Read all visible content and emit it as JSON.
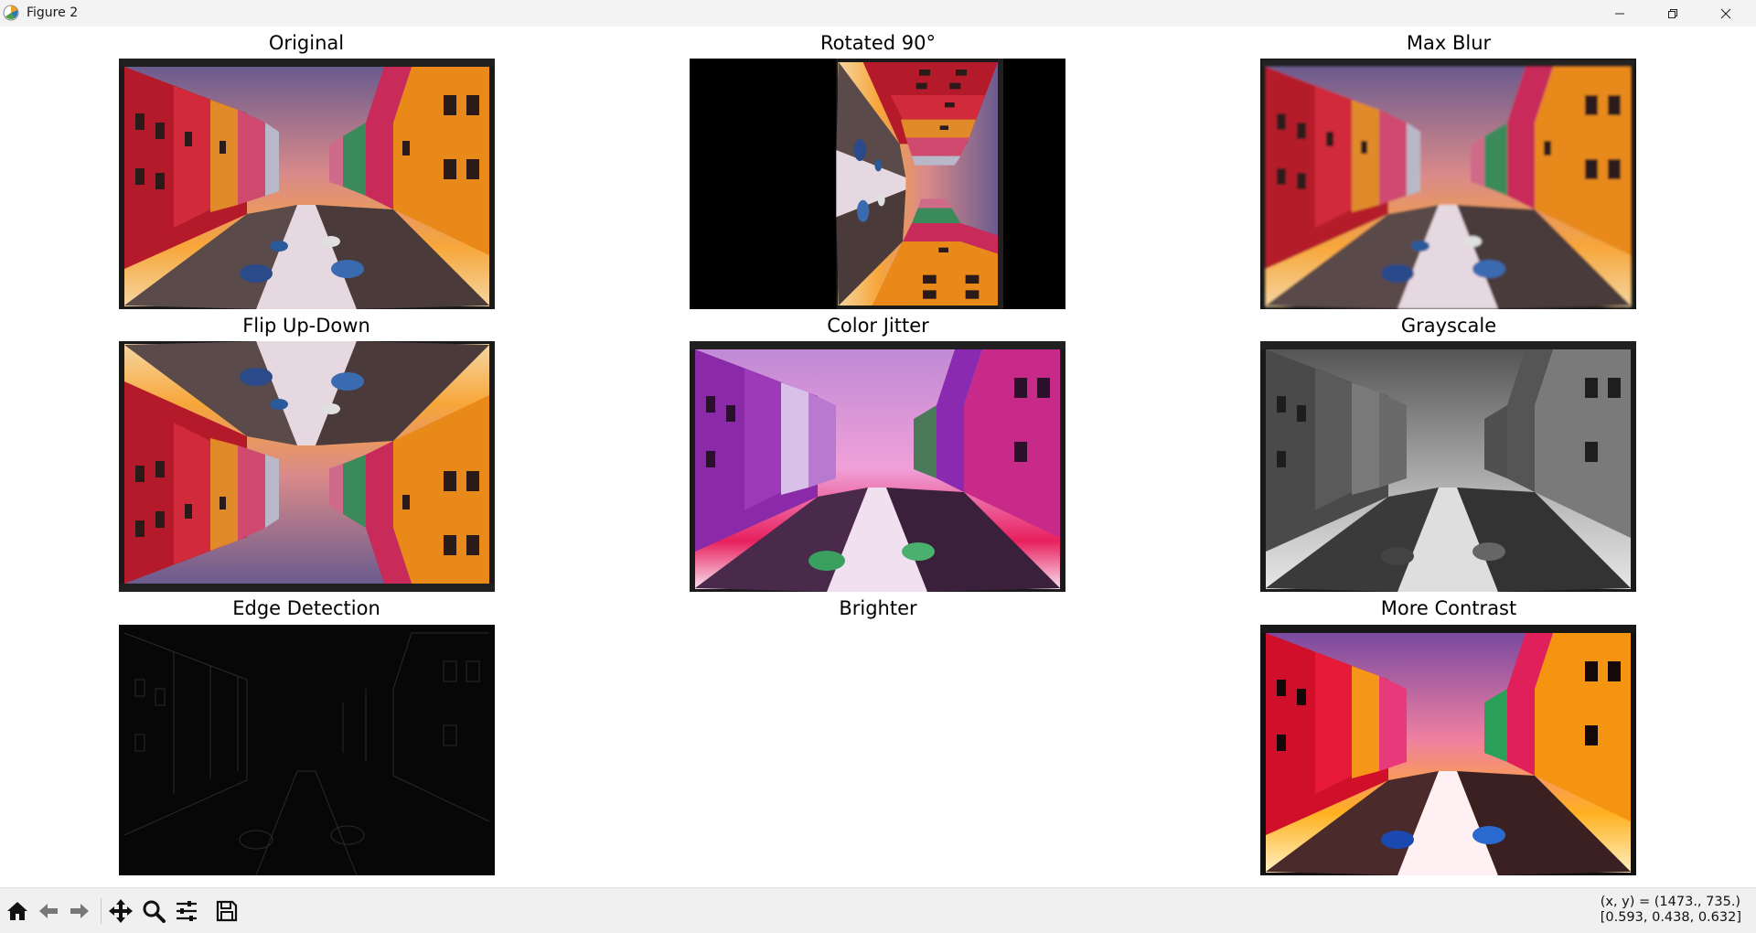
{
  "window": {
    "title": "Figure 2",
    "controls": [
      "minimize",
      "restore",
      "close"
    ]
  },
  "panels": [
    {
      "title": "Original",
      "image": "canal-original"
    },
    {
      "title": "Rotated 90°",
      "image": "canal-rotated-90"
    },
    {
      "title": "Max Blur",
      "image": "canal-max-blur"
    },
    {
      "title": "Flip Up-Down",
      "image": "canal-flipped-vertical"
    },
    {
      "title": "Color Jitter",
      "image": "canal-color-jitter"
    },
    {
      "title": "Grayscale",
      "image": "canal-grayscale"
    },
    {
      "title": "Edge Detection",
      "image": "canal-edges"
    },
    {
      "title": "Brighter",
      "image": "none"
    },
    {
      "title": "More Contrast",
      "image": "canal-more-contrast"
    }
  ],
  "toolbar": {
    "buttons": [
      "home-icon",
      "back-icon",
      "forward-icon",
      "pan-icon",
      "zoom-icon",
      "configure-subplots-icon",
      "save-icon"
    ]
  },
  "status": {
    "coords_line1": "(x, y) = (1473., 735.)",
    "coords_line2": "[0.593, 0.438, 0.632]"
  },
  "colors": {
    "sky_warm": "#f2a23c",
    "sky_pink": "#d46a8c",
    "house_red": "#c0202e",
    "house_orange": "#e0871a",
    "water": "#e8dcd8",
    "jitter_purple": "#8d2aa8",
    "jitter_magenta": "#e0388a"
  }
}
